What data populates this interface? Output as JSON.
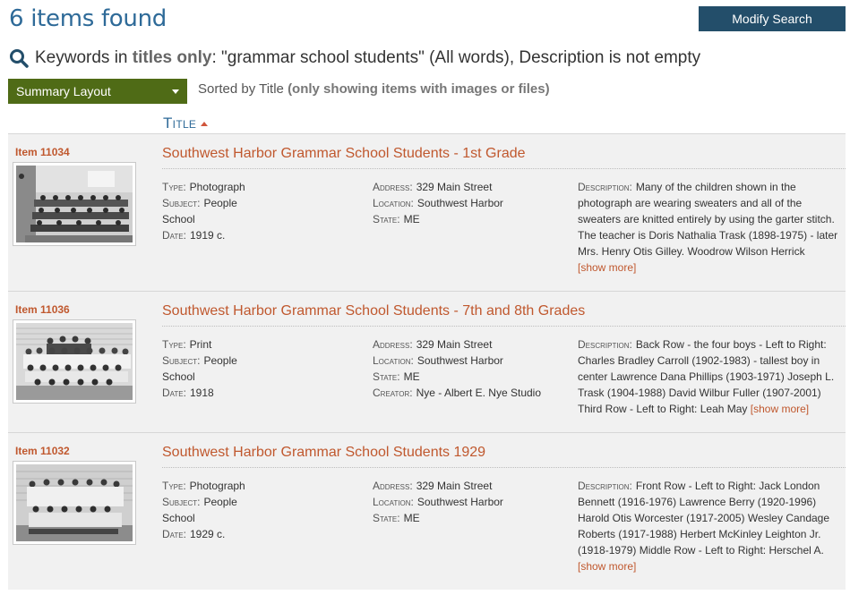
{
  "header": {
    "found": "6 items found",
    "modify_label": "Modify Search"
  },
  "search": {
    "prefix": "Keywords in",
    "scope": "titles only",
    "query": ": \"grammar school students\" (All words), Description is not empty"
  },
  "layout": {
    "selected": "Summary Layout"
  },
  "sort": {
    "prefix": "Sorted by Title",
    "note": "(only showing items with images or files)"
  },
  "columns": {
    "title": "Title"
  },
  "items": [
    {
      "id": "Item 11034",
      "title": "Southwest Harbor Grammar School Students - 1st Grade",
      "type_label": "Type:",
      "type": "Photograph",
      "subject_label": "Subject:",
      "subject_1": "People",
      "subject_2": "School",
      "date_label": "Date:",
      "date": "1919 c.",
      "address_label": "Address:",
      "address": "329 Main Street",
      "location_label": "Location:",
      "location": "Southwest Harbor",
      "state_label": "State:",
      "state": "ME",
      "creator_label": "",
      "creator": "",
      "desc_label": "Description:",
      "desc_lines": [
        "Many of the children shown in the",
        "photograph are wearing sweaters and all of the",
        "sweaters are knitted entirely by using the garter stitch.",
        "The teacher is Doris Nathalia Trask (1898-1975) - later",
        "Mrs. Henry Otis Gilley. Woodrow Wilson Herrick"
      ],
      "desc_tail": "",
      "more": "[show more]"
    },
    {
      "id": "Item 11036",
      "title": "Southwest Harbor Grammar School Students - 7th and 8th Grades",
      "type_label": "Type:",
      "type": "Print",
      "subject_label": "Subject:",
      "subject_1": "People",
      "subject_2": "School",
      "date_label": "Date:",
      "date": "1918",
      "address_label": "Address:",
      "address": "329 Main Street",
      "location_label": "Location:",
      "location": "Southwest Harbor",
      "state_label": "State:",
      "state": "ME",
      "creator_label": "Creator:",
      "creator": "Nye - Albert E. Nye Studio",
      "desc_label": "Description:",
      "desc_lines": [
        "Back Row - the four boys - Left to Right:",
        "Charles Bradley Carroll (1902-1983) - tallest boy in",
        "center Lawrence Dana Phillips (1903-1971) Joseph L.",
        "Trask (1904-1988) David Wilbur Fuller (1907-2001)"
      ],
      "desc_tail": "Third Row - Left to Right: Leah May",
      "more": "[show more]"
    },
    {
      "id": "Item 11032",
      "title": "Southwest Harbor Grammar School Students 1929",
      "type_label": "Type:",
      "type": "Photograph",
      "subject_label": "Subject:",
      "subject_1": "People",
      "subject_2": "School",
      "date_label": "Date:",
      "date": "1929 c.",
      "address_label": "Address:",
      "address": "329 Main Street",
      "location_label": "Location:",
      "location": "Southwest Harbor",
      "state_label": "State:",
      "state": "ME",
      "creator_label": "",
      "creator": "",
      "desc_label": "Description:",
      "desc_lines": [
        "Front Row - Left to Right: Jack London",
        "Bennett (1916-1976) Lawrence Berry (1920-1996)",
        "Harold Otis Worcester (1917-2005) Wesley Candage",
        "Roberts (1917-1988) Herbert McKinley Leighton Jr.",
        "(1918-1979) Middle Row - Left to Right: Herschel A."
      ],
      "desc_tail": "",
      "more": "[show more]"
    }
  ]
}
